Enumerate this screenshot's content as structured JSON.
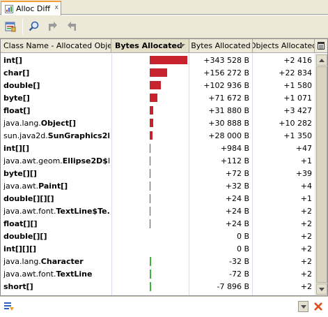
{
  "tab": {
    "title": "Alloc Diff",
    "close_glyph": "x"
  },
  "toolbar": {
    "buttons": [
      {
        "name": "snapshot-icon"
      },
      {
        "name": "find-icon"
      },
      {
        "name": "previous-icon"
      },
      {
        "name": "next-icon"
      }
    ]
  },
  "table": {
    "columns": [
      "Class Name - Allocated Objects",
      "Bytes Allocated",
      "Bytes Allocated",
      "Objects Allocated"
    ],
    "sort_column": "Bytes Allocated",
    "sort_direction": "descending",
    "bar_max_bytes": 343528,
    "rows": [
      {
        "pkg": "",
        "cls": "int[]",
        "bytes_text": "+343 528 B",
        "objs_text": "+2 416",
        "bytes": 343528
      },
      {
        "pkg": "",
        "cls": "char[]",
        "bytes_text": "+156 272 B",
        "objs_text": "+22 834",
        "bytes": 156272
      },
      {
        "pkg": "",
        "cls": "double[]",
        "bytes_text": "+102 936 B",
        "objs_text": "+1 580",
        "bytes": 102936
      },
      {
        "pkg": "",
        "cls": "byte[]",
        "bytes_text": "+71 672 B",
        "objs_text": "+1 071",
        "bytes": 71672
      },
      {
        "pkg": "",
        "cls": "float[]",
        "bytes_text": "+31 880 B",
        "objs_text": "+3 427",
        "bytes": 31880
      },
      {
        "pkg": "java.lang.",
        "cls": "Object[]",
        "bytes_text": "+30 888 B",
        "objs_text": "+10 282",
        "bytes": 30888
      },
      {
        "pkg": "sun.java2d.",
        "cls": "SunGraphics2D",
        "bytes_text": "+28 000 B",
        "objs_text": "+1 350",
        "bytes": 28000
      },
      {
        "pkg": "",
        "cls": "int[][]",
        "bytes_text": "+984 B",
        "objs_text": "+47",
        "bytes": 984
      },
      {
        "pkg": "java.awt.geom.",
        "cls": "Ellipse2D$F...",
        "bytes_text": "+112 B",
        "objs_text": "+1",
        "bytes": 112
      },
      {
        "pkg": "",
        "cls": "byte[][]",
        "bytes_text": "+72 B",
        "objs_text": "+39",
        "bytes": 72
      },
      {
        "pkg": "java.awt.",
        "cls": "Paint[]",
        "bytes_text": "+32 B",
        "objs_text": "+4",
        "bytes": 32
      },
      {
        "pkg": "",
        "cls": "double[][][]",
        "bytes_text": "+24 B",
        "objs_text": "+1",
        "bytes": 24
      },
      {
        "pkg": "java.awt.font.",
        "cls": "TextLine$Te...",
        "bytes_text": "+24 B",
        "objs_text": "+2",
        "bytes": 24
      },
      {
        "pkg": "",
        "cls": "float[][]",
        "bytes_text": "+24 B",
        "objs_text": "+2",
        "bytes": 24
      },
      {
        "pkg": "",
        "cls": "double[][]",
        "bytes_text": "0 B",
        "objs_text": "+2",
        "bytes": 0
      },
      {
        "pkg": "",
        "cls": "int[][][]",
        "bytes_text": "0 B",
        "objs_text": "+2",
        "bytes": 0
      },
      {
        "pkg": "java.lang.",
        "cls": "Character",
        "bytes_text": "-32 B",
        "objs_text": "+2",
        "bytes": -32
      },
      {
        "pkg": "java.awt.font.",
        "cls": "TextLine",
        "bytes_text": "-72 B",
        "objs_text": "+2",
        "bytes": -72
      },
      {
        "pkg": "",
        "cls": "short[]",
        "bytes_text": "-7 896 B",
        "objs_text": "+2",
        "bytes": -7896
      }
    ]
  },
  "filter": {
    "value": "",
    "placeholder": ""
  },
  "colors": {
    "positive_bar": "#c6232e",
    "negative_bar": "#3cb33c",
    "tab_accent": "#f2a03d"
  }
}
